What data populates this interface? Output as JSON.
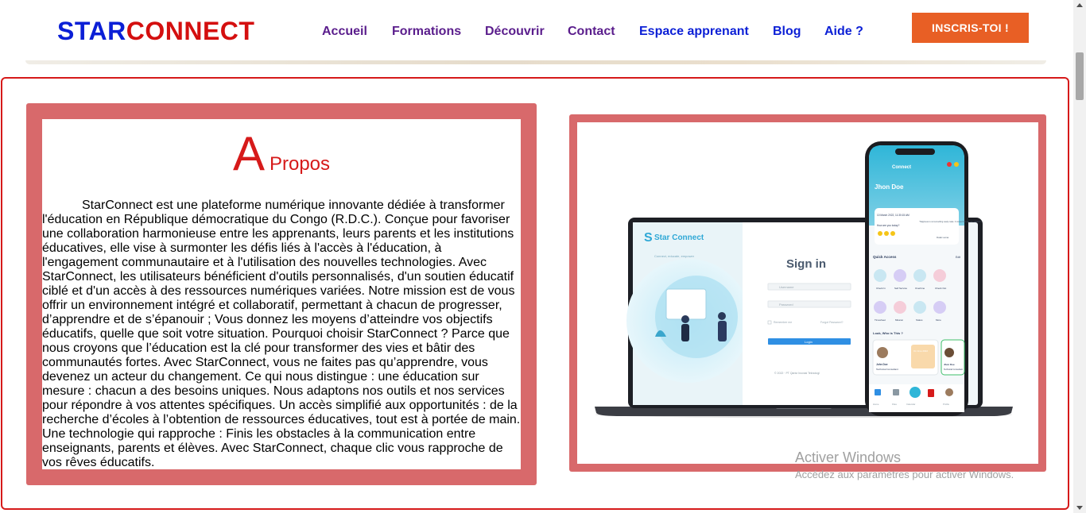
{
  "header": {
    "logo_part1": "STAR",
    "logo_part2": "CONNECT",
    "nav": [
      "Accueil",
      "Formations",
      "Découvrir",
      "Contact",
      "Espace apprenant",
      "Blog",
      "Aide ?"
    ],
    "cta": "INSCRIS-TOI !"
  },
  "about": {
    "title_big": "A",
    "title_small": "Propos",
    "text": "StarConnect est une plateforme numérique innovante dédiée à transformer l'éducation en République démocratique du Congo (R.D.C.). Conçue pour favoriser une collaboration harmonieuse entre les apprenants, leurs parents et les institutions éducatives, elle vise à surmonter les défis liés à l'accès à l'éducation, à l'engagement communautaire et à l'utilisation des nouvelles technologies. Avec StarConnect, les utilisateurs bénéficient d'outils personnalisés, d'un soutien éducatif ciblé et d'un accès à des ressources numériques variées. Notre mission est de vous offrir un environnement intégré et collaboratif, permettant à chacun de progresser, d’apprendre et de s’épanouir ; Vous donnez les moyens d’atteindre vos objectifs éducatifs, quelle que soit votre situation. Pourquoi choisir StarConnect ? Parce que nous croyons que l’éducation est la clé pour transformer des vies et bâtir des communautés fortes. Avec StarConnect, vous ne faites pas qu’apprendre, vous devenez un acteur du changement. Ce qui nous distingue : une éducation sur mesure : chacun a des besoins uniques. Nous adaptons nos outils et nos services pour répondre à vos attentes spécifiques. Un accès simplifié aux opportunités : de la recherche d’écoles à l’obtention de ressources éducatives, tout est à portée de main. Une technologie qui rapproche : Finis les obstacles à la communication entre enseignants, parents et élèves. Avec StarConnect, chaque clic vous rapproche de vos rêves éducatifs."
  },
  "mockup": {
    "laptop_brand": "Star Connect",
    "laptop_tagline": "Connect, educate, empower",
    "signin_title": "Sign in",
    "username_placeholder": "Username",
    "password_placeholder": "Password",
    "remember_me": "Remember me",
    "forgot_password": "Forgot Password?",
    "login_button": "Login",
    "footer_text": "© 2022 · PT Qantz Inovasi Teknologi",
    "phone_brand": "Connect",
    "phone_user": "Jhon Doe",
    "phone_date": "10 March 2022, 11:30:15 AM",
    "phone_question": "How are you today?",
    "phone_quote": "\"Happiness is not something ready made. It comes from our own actions.\"",
    "phone_quote_author": "Dalai Lama",
    "quick_access": "Quick Access",
    "quick_access_edit": "Edit",
    "quick_items": [
      "Check In",
      "Self Service",
      "Overtime",
      "Check Out",
      "Timesheet",
      "Mission",
      "Status",
      "More"
    ],
    "who_title": "Look, Who is This ?",
    "who_person1": "John Doe",
    "who_role1": "Technical Consultant",
    "who_badge1": "On time 2022",
    "who_person2": "Jhon Doe",
    "who_role2": "Technical Consultant",
    "nav_labels": [
      "Home",
      "Files",
      "Calendar",
      "Profile"
    ]
  },
  "watermark": {
    "line1": "Activer Windows",
    "line2": "Accédez aux paramètres pour activer Windows."
  },
  "colors": {
    "logo_blue": "#0b1fd6",
    "logo_red": "#d40f0f",
    "nav_purple": "#5a1d8c",
    "nav_blue": "#0b1fd6",
    "cta_orange": "#e85f25",
    "card_frame": "#d8696b",
    "section_border": "#d61a1a"
  }
}
